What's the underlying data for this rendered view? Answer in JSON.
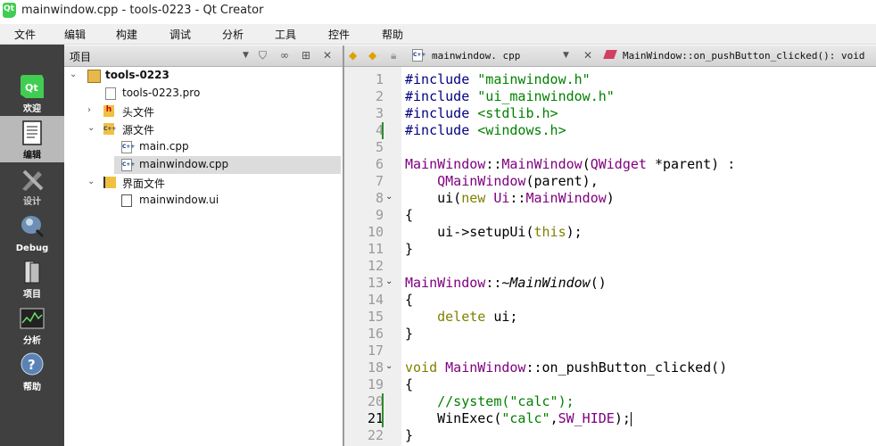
{
  "window": {
    "title": "mainwindow.cpp - tools-0223 - Qt Creator"
  },
  "menu": [
    "文件",
    "编辑",
    "构建",
    "调试",
    "分析",
    "工具",
    "控件",
    "帮助"
  ],
  "modes": [
    {
      "label": "欢迎",
      "icon": "qt-logo-icon",
      "active": false
    },
    {
      "label": "编辑",
      "icon": "edit-document-icon",
      "active": true
    },
    {
      "label": "设计",
      "icon": "design-icon",
      "active": false
    },
    {
      "label": "Debug",
      "icon": "debug-icon",
      "active": false
    },
    {
      "label": "项目",
      "icon": "project-icon",
      "active": false
    },
    {
      "label": "分析",
      "icon": "analyze-icon",
      "active": false
    },
    {
      "label": "帮助",
      "icon": "help-icon",
      "active": false
    }
  ],
  "project_panel": {
    "title": "项目",
    "tree": [
      {
        "label": "tools-0223",
        "bold": true
      },
      {
        "label": "tools-0223.pro"
      },
      {
        "label": "头文件"
      },
      {
        "label": "源文件"
      },
      {
        "label": "main.cpp"
      },
      {
        "label": "mainwindow.cpp",
        "selected": true
      },
      {
        "label": "界面文件"
      },
      {
        "label": "mainwindow.ui"
      }
    ]
  },
  "editor": {
    "file_name": "mainwindow. cpp",
    "symbol": "MainWindow::on_pushButton_clicked(): void",
    "current_line": 21,
    "line_numbers": [
      "1",
      "2",
      "3",
      "4",
      "5",
      "6",
      "7",
      "8",
      "9",
      "10",
      "11",
      "12",
      "13",
      "14",
      "15",
      "16",
      "17",
      "18",
      "19",
      "20",
      "21",
      "22"
    ],
    "lines": [
      "#include \"mainwindow.h\"",
      "#include \"ui_mainwindow.h\"",
      "#include <stdlib.h>",
      "#include <windows.h>",
      "",
      "MainWindow::MainWindow(QWidget *parent) :",
      "    QMainWindow(parent),",
      "    ui(new Ui::MainWindow)",
      "{",
      "    ui->setupUi(this);",
      "}",
      "",
      "MainWindow::~MainWindow()",
      "{",
      "    delete ui;",
      "}",
      "",
      "void MainWindow::on_pushButton_clicked()",
      "{",
      "    //system(\"calc\");",
      "    WinExec(\"calc\",SW_HIDE);",
      "}"
    ]
  },
  "colors": {
    "keyword": "#808000",
    "type": "#800080",
    "string": "#008000",
    "preprocessor": "#000080",
    "sidebar_bg": "#404040"
  }
}
